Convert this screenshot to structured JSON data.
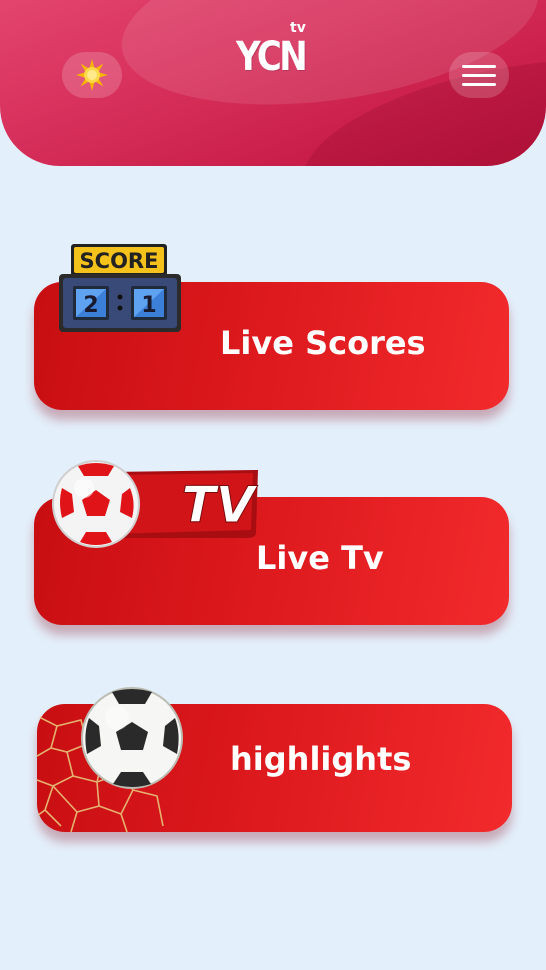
{
  "header": {
    "logo_main": "YCN",
    "logo_sup": "tv",
    "theme_icon": "sun-icon",
    "menu_icon": "hamburger-menu-icon",
    "colors": {
      "header": "#d72f5b",
      "background": "#e3effa"
    }
  },
  "cards": {
    "scores": {
      "label": "Live Scores",
      "badge_title": "SCORE",
      "home_score": "2",
      "away_score": "1",
      "icon": "scoreboard-icon"
    },
    "tv": {
      "label": "Live Tv",
      "badge_text": "TV",
      "icon": "soccer-ball-tv-icon"
    },
    "highlights": {
      "label": "highlights",
      "icon": "soccer-ball-net-icon"
    },
    "colors": {
      "card": "#e01c20",
      "label": "#ffffff"
    }
  }
}
